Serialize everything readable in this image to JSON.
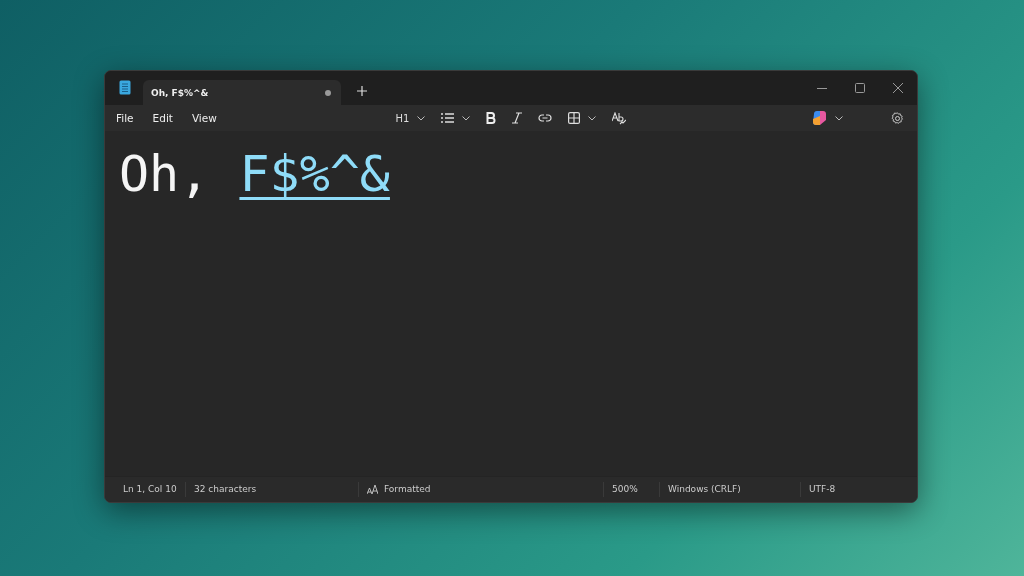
{
  "window": {
    "tab": {
      "title": "Oh, F$%^&",
      "modified": true,
      "selected": true
    }
  },
  "menu": [
    "File",
    "Edit",
    "View"
  ],
  "toolbar": {
    "heading": "H1"
  },
  "document": {
    "segments": [
      {
        "kind": "text",
        "text": "Oh,"
      },
      {
        "kind": "link",
        "text": "F$%^&"
      }
    ]
  },
  "status_bar": {
    "position": "Ln 1, Col 10",
    "characters": "32 characters",
    "mode": "Formatted",
    "zoom": "500%",
    "line_ending": "Windows (CRLF)",
    "encoding": "UTF-8"
  }
}
